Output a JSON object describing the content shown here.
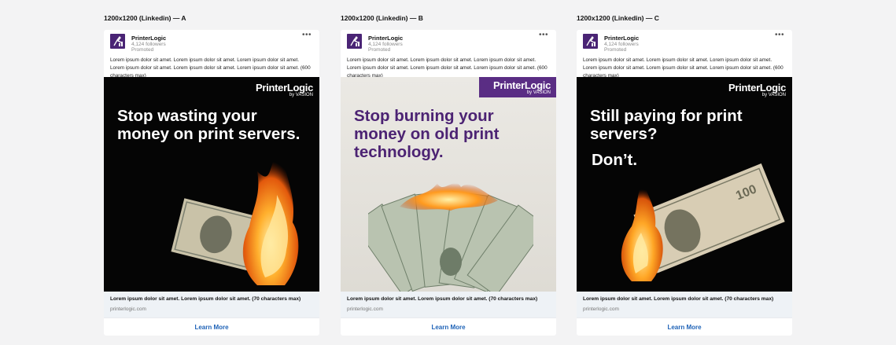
{
  "variants": [
    {
      "title": "1200x1200 (Linkedin) — A",
      "company": "PrinterLogic",
      "followers": "4,124 followers",
      "promoted": "Promoted",
      "menu": "•••",
      "post_text": "Lorem ipsum dolor sit amet. Lorem ipsum dolor sit amet. Lorem ipsum dolor sit amet. Lorem ipsum dolor sit amet. Lorem ipsum dolor sit amet. Lorem ipsum dolor sit amet. (600 characters max)",
      "brand_name": "PrinterLogic",
      "brand_sub": "by VASION",
      "headline": "Stop wasting your money on print servers.",
      "footer_title": "Lorem ipsum dolor sit amet. Lorem ipsum dolor sit amet. (70 characters max)",
      "footer_url": "printerlogic.com",
      "cta": "Learn More",
      "theme": "dark"
    },
    {
      "title": "1200x1200 (Linkedin) — B",
      "company": "PrinterLogic",
      "followers": "4,124 followers",
      "promoted": "Promoted",
      "menu": "•••",
      "post_text": "Lorem ipsum dolor sit amet. Lorem ipsum dolor sit amet. Lorem ipsum dolor sit amet. Lorem ipsum dolor sit amet. Lorem ipsum dolor sit amet. Lorem ipsum dolor sit amet. (600 characters max)",
      "brand_name": "PrinterLogic",
      "brand_sub": "by VASION",
      "headline": "Stop burning your money on old print technology.",
      "footer_title": "Lorem ipsum dolor sit amet. Lorem ipsum dolor sit amet. (70 characters max)",
      "footer_url": "printerlogic.com",
      "cta": "Learn More",
      "theme": "light"
    },
    {
      "title": "1200x1200 (Linkedin) — C",
      "company": "PrinterLogic",
      "followers": "4,124 followers",
      "promoted": "Promoted",
      "menu": "•••",
      "post_text": "Lorem ipsum dolor sit amet. Lorem ipsum dolor sit amet. Lorem ipsum dolor sit amet. Lorem ipsum dolor sit amet. Lorem ipsum dolor sit amet. Lorem ipsum dolor sit amet. (600 characters max)",
      "brand_name": "PrinterLogic",
      "brand_sub": "by VASION",
      "headline": "Still paying for print servers?",
      "subline": "Don’t.",
      "footer_title": "Lorem ipsum dolor sit amet. Lorem ipsum dolor sit amet. (70 characters max)",
      "footer_url": "printerlogic.com",
      "cta": "Learn More",
      "theme": "dark"
    }
  ],
  "colors": {
    "page_bg": "#f3f3f4",
    "brand_purple": "#4a2475",
    "headline_purple": "#4c2373",
    "link_blue": "#1f63b7",
    "footer_bg": "#eef2f6"
  },
  "icons": {
    "logo": "printerlogic-logo-icon",
    "menu": "more-options-icon"
  }
}
